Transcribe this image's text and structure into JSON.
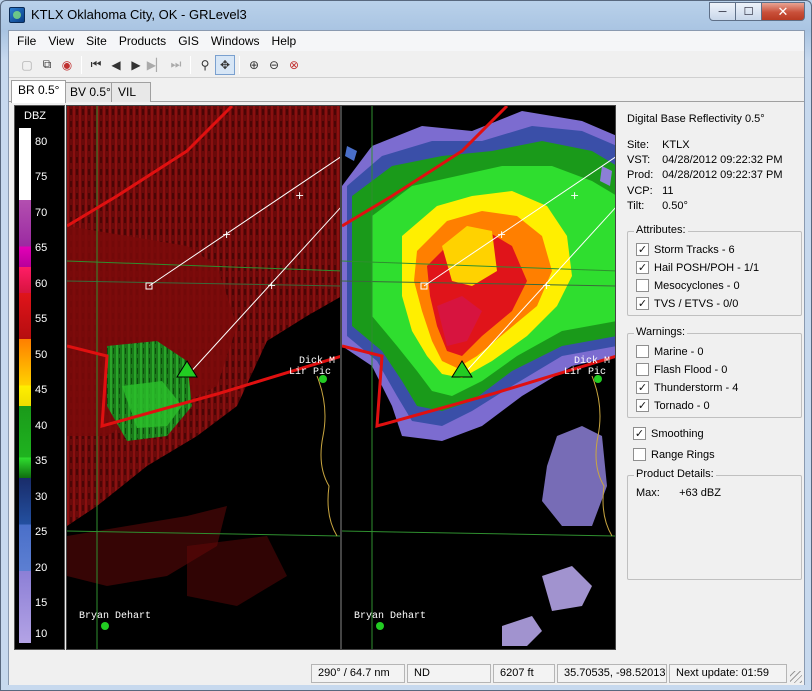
{
  "window": {
    "title": "KTLX Oklahoma City, OK - GRLevel3",
    "minimize": "─",
    "maximize": "☐",
    "close": "✕"
  },
  "menu": [
    "File",
    "View",
    "Site",
    "Products",
    "GIS",
    "Windows",
    "Help"
  ],
  "toolbar": {
    "icons": [
      "page-icon",
      "copy-icon",
      "record-icon",
      "first-frame-icon",
      "prev-frame-icon",
      "play-icon",
      "next-frame-icon",
      "last-frame-icon",
      "zoom-icon",
      "pan-icon",
      "zoom-in-icon",
      "zoom-out-icon",
      "zoom-reset-icon"
    ]
  },
  "tabs": [
    {
      "label": "BR 0.5°",
      "active": true
    },
    {
      "label": "BV 0.5°",
      "active": false
    },
    {
      "label": "VIL",
      "active": false
    }
  ],
  "colorbar": {
    "unit": "DBZ",
    "labels": [
      "80",
      "75",
      "70",
      "65",
      "60",
      "55",
      "50",
      "45",
      "40",
      "35",
      "30",
      "25",
      "20",
      "15",
      "10"
    ]
  },
  "map_labels": {
    "left": {
      "dick": "Dick M",
      "lir": "Lir Pic",
      "bryan": "Bryan Dehart"
    },
    "right": {
      "dick": "Dick M",
      "lir": "Lir Pic",
      "bryan": "Bryan Dehart"
    }
  },
  "panel": {
    "product_name": "Digital Base Reflectivity 0.5°",
    "site_label": "Site:",
    "site_value": "KTLX",
    "vst_label": "VST:",
    "vst_value": "04/28/2012  09:22:32 PM",
    "prod_label": "Prod:",
    "prod_value": "04/28/2012  09:22:37 PM",
    "vcp_label": "VCP:",
    "vcp_value": "11",
    "tilt_label": "Tilt:",
    "tilt_value": "0.50°",
    "attributes_label": "Attributes:",
    "attributes": [
      {
        "label": "Storm Tracks - 6",
        "checked": true
      },
      {
        "label": "Hail POSH/POH - 1/1",
        "checked": true
      },
      {
        "label": "Mesocyclones - 0",
        "checked": false
      },
      {
        "label": "TVS / ETVS - 0/0",
        "checked": true
      }
    ],
    "warnings_label": "Warnings:",
    "warnings": [
      {
        "label": "Marine - 0",
        "checked": false
      },
      {
        "label": "Flash Flood - 0",
        "checked": false
      },
      {
        "label": "Thunderstorm - 4",
        "checked": true
      },
      {
        "label": "Tornado - 0",
        "checked": true
      }
    ],
    "smoothing_label": "Smoothing",
    "smoothing_checked": true,
    "range_rings_label": "Range Rings",
    "range_rings_checked": false,
    "details_label": "Product Details:",
    "max_label": "Max:",
    "max_value": "+63 dBZ"
  },
  "status": {
    "azimuth_range": "290° / 64.7 nm",
    "value": "ND",
    "height": "6207 ft",
    "coords": "35.70535, -98.52013",
    "next_update": "Next update: 01:59"
  },
  "colors": {
    "warning_polygon": "#e01010",
    "storm_track": "#ffffff",
    "storm_marker": "#22cc22",
    "county_line": "#2f8f2f",
    "river": "#c9a640"
  }
}
